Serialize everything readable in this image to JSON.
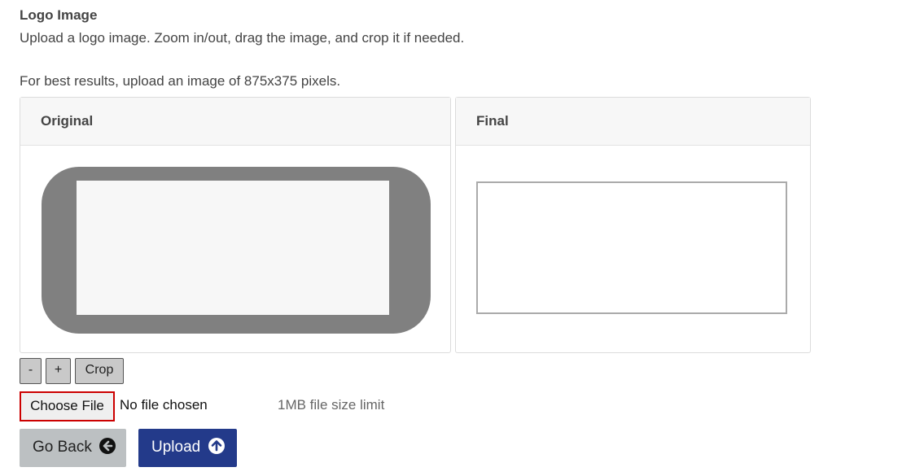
{
  "section": {
    "title": "Logo Image",
    "description": "Upload a logo image. Zoom in/out, drag the image, and crop it if needed.",
    "hint": "For best results, upload an image of 875x375 pixels."
  },
  "panels": {
    "original": {
      "title": "Original"
    },
    "final": {
      "title": "Final"
    }
  },
  "controls": {
    "zoom_out": "-",
    "zoom_in": "+",
    "crop": "Crop"
  },
  "file_input": {
    "button_label": "Choose File",
    "status": "No file chosen",
    "size_limit": "1MB file size limit"
  },
  "actions": {
    "back_label": "Go Back",
    "back_icon": "arrow-left-circle-icon",
    "upload_label": "Upload",
    "upload_icon": "arrow-up-circle-icon"
  },
  "colors": {
    "upload_button": "#233a8a",
    "back_button": "#bcc0c2",
    "file_focus_outline": "#cc0000"
  }
}
